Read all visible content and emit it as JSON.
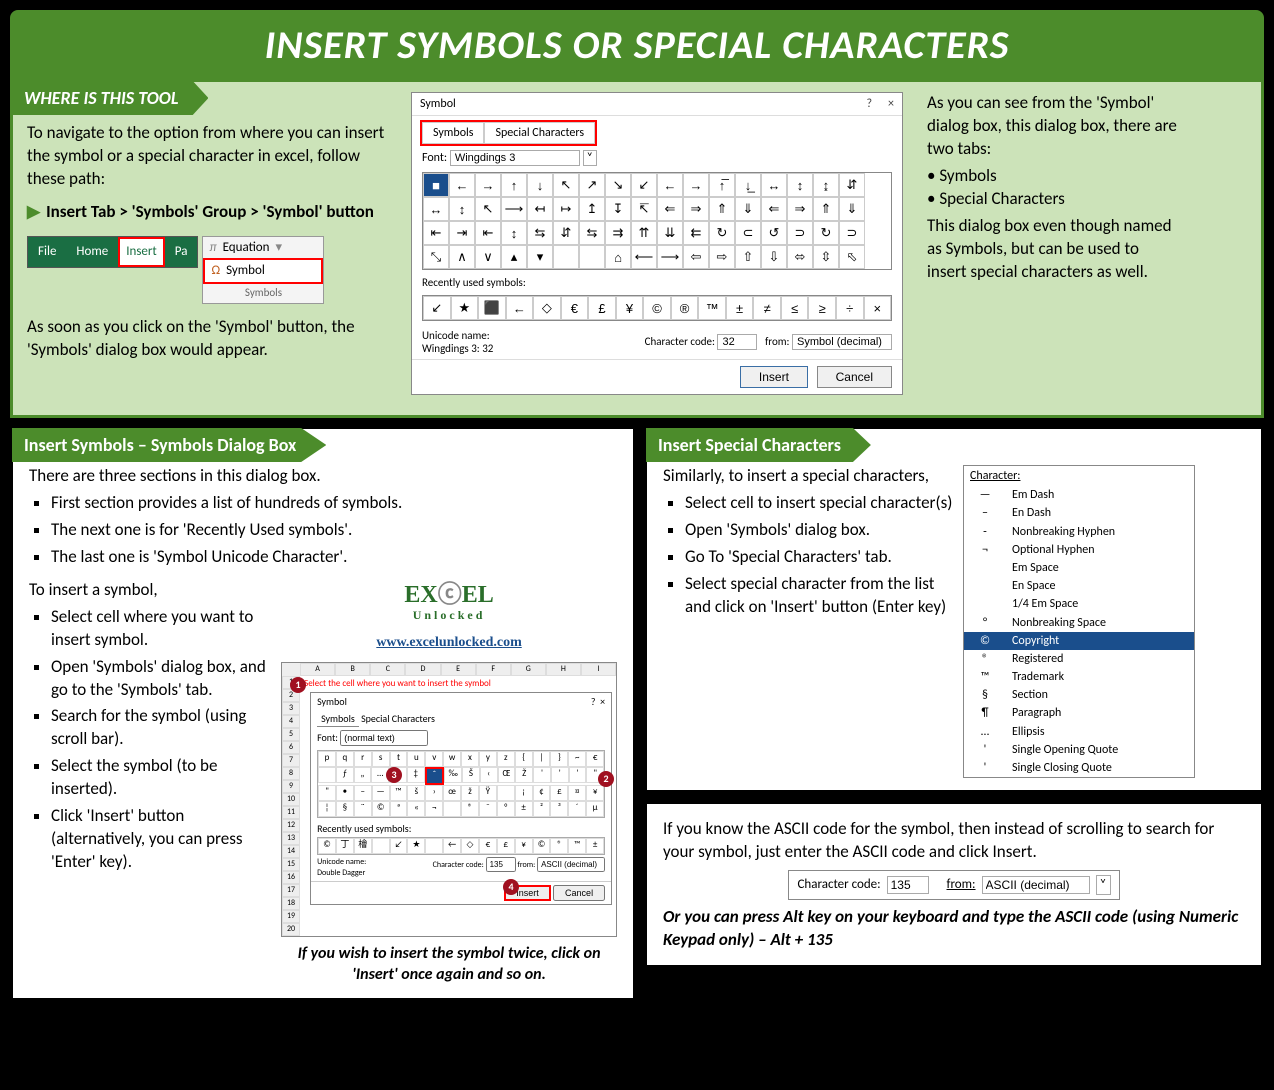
{
  "title": "INSERT SYMBOLS OR SPECIAL CHARACTERS",
  "s1": {
    "header": "WHERE IS THIS TOOL",
    "intro": "To navigate to the option from where you can insert the symbol or a special character in excel, follow these path:",
    "navpath": "Insert Tab > 'Symbols' Group > 'Symbol' button",
    "tabs": {
      "file": "File",
      "home": "Home",
      "insert": "Insert",
      "pa": "Pa"
    },
    "group": {
      "equation": "Equation",
      "symbol": "Symbol",
      "footer": "Symbols",
      "pi": "π",
      "omega": "Ω"
    },
    "after": "As soon as you click on the 'Symbol' button, the 'Symbols' dialog box would appear.",
    "dlg": {
      "title": "Symbol",
      "help": "?",
      "close": "×",
      "tabSymbols": "Symbols",
      "tabSpecial": "Special Characters",
      "fontLbl": "Font:",
      "fontVal": "Wingdings 3",
      "recentLbl": "Recently used symbols:",
      "recent": [
        "↙",
        "★",
        "⬛",
        "←",
        "◇",
        "€",
        "£",
        "¥",
        "©",
        "®",
        "™",
        "±",
        "≠",
        "≤",
        "≥",
        "÷",
        "×"
      ],
      "unicodeLbl": "Unicode name:",
      "unicodeVal": "Wingdings 3: 32",
      "charCodeLbl": "Character code:",
      "charCodeVal": "32",
      "fromLbl": "from:",
      "fromVal": "Symbol (decimal)",
      "insert": "Insert",
      "cancel": "Cancel",
      "gridRows": [
        [
          "■",
          "←",
          "→",
          "↑",
          "↓",
          "↖",
          "↗",
          "↘",
          "↙",
          "←",
          "→",
          "↑̅",
          "↓̲",
          "↔",
          "↕",
          "↨",
          "⇵"
        ],
        [
          "↔",
          "↕",
          "↖",
          "⟶",
          "↤",
          "↦",
          "↥",
          "↧",
          "↸",
          "⇐",
          "⇒",
          "⇑",
          "⇓",
          "⇐",
          "⇒",
          "⇑",
          "⇓"
        ],
        [
          "⇤",
          "⇥",
          "⇤",
          "↕",
          "⇆",
          "⇵",
          "⇆",
          "⇉",
          "⇈",
          "⇊",
          "⇇",
          "↻",
          "⊂",
          "↺",
          "⊃",
          "↻",
          "⊃"
        ],
        [
          "⤡",
          "∧",
          "∨",
          "▴",
          "▾",
          "",
          "",
          "⌂",
          "⟵",
          "⟶",
          "⇦",
          "⇨",
          "⇧",
          "⇩",
          "⬄",
          "⇳",
          "⬁"
        ]
      ]
    },
    "right": {
      "p1": "As you can see from the 'Symbol' dialog box, this dialog box, there are two tabs:",
      "b1": "Symbols",
      "b2": "Special Characters",
      "p2": "This dialog box even though named as Symbols, but can be used to insert special characters as well."
    }
  },
  "s2": {
    "header": "Insert Symbols – Symbols Dialog Box",
    "p1": "There are three sections in this dialog box.",
    "bullets1": [
      "First section provides a list of hundreds of symbols.",
      "The next one is for 'Recently Used symbols'.",
      "The last one is 'Symbol Unicode Character'."
    ],
    "p2": "To insert a symbol,",
    "bullets2": [
      "Select cell where you want to insert symbol.",
      "Open 'Symbols' dialog box, and go to the 'Symbols' tab.",
      "Search for the symbol (using scroll bar).",
      "Select the symbol (to be inserted).",
      "Click 'Insert' button (alternatively, you can press 'Enter' key)."
    ],
    "logo1": "EXCEL",
    "logo2": "Unlocked",
    "logoUrl": "www.excelunlocked.com",
    "caption": "If you wish to insert the symbol twice, click on 'Insert' once again and so on.",
    "mini": {
      "redtext": "Select the cell where you want to insert the symbol",
      "title": "Symbol",
      "tabSymbols": "Symbols",
      "tabSpecial": "Special Characters",
      "fontLbl": "Font:",
      "fontVal": "(normal text)",
      "r1": [
        "p",
        "q",
        "r",
        "s",
        "t",
        "u",
        "v",
        "w",
        "x",
        "y",
        "z",
        "{",
        "|",
        "}",
        "~",
        "€"
      ],
      "r2": [
        "",
        "ƒ",
        "„",
        "…",
        "†",
        "‡",
        "ˆ",
        "‰",
        "Š",
        "‹",
        "Œ",
        "Ž",
        "'",
        "'",
        "'",
        "\""
      ],
      "r3": [
        "\"",
        "•",
        "–",
        "—",
        "™",
        "š",
        "›",
        "œ",
        "ž",
        "Ÿ",
        "",
        "¡",
        "¢",
        "£",
        "¤",
        "¥"
      ],
      "r4": [
        "¦",
        "§",
        "¨",
        "©",
        "ª",
        "«",
        "¬",
        "",
        "®",
        "¯",
        "°",
        "±",
        "²",
        "³",
        "´",
        "µ"
      ],
      "recentLbl": "Recently used symbols:",
      "recent": [
        "©",
        "丁",
        "檜",
        "",
        "↙",
        "★",
        "",
        "←",
        "◇",
        "€",
        "£",
        "¥",
        "©",
        "®",
        "™",
        "±"
      ],
      "unicodeLbl": "Unicode name:",
      "unicodeVal": "Double Dagger",
      "charCodeLbl": "Character code:",
      "charCodeVal": "135",
      "fromLbl": "from:",
      "fromVal": "ASCII (decimal)",
      "insert": "Insert",
      "cancel": "Cancel",
      "cols": [
        "A",
        "B",
        "C",
        "D",
        "E",
        "F",
        "G",
        "H",
        "I"
      ],
      "rows": [
        "1",
        "2",
        "3",
        "4",
        "5",
        "6",
        "7",
        "8",
        "9",
        "10",
        "11",
        "12",
        "13",
        "14",
        "15",
        "16",
        "17",
        "18",
        "19",
        "20"
      ]
    }
  },
  "s3": {
    "header": "Insert Special Characters",
    "p1": "Similarly, to insert a special characters,",
    "bullets": [
      "Select cell to insert special character(s)",
      "Open 'Symbols' dialog box.",
      "Go To 'Special Characters' tab.",
      "Select special character from the list and click on 'Insert' button (Enter key)"
    ],
    "charHdr": "Character:",
    "chars": [
      {
        "s": "—",
        "n": "Em Dash"
      },
      {
        "s": "–",
        "n": "En Dash"
      },
      {
        "s": "-",
        "n": "Nonbreaking Hyphen"
      },
      {
        "s": "¬",
        "n": "Optional Hyphen"
      },
      {
        "s": "",
        "n": "Em Space"
      },
      {
        "s": "",
        "n": "En Space"
      },
      {
        "s": "",
        "n": "1/4 Em Space"
      },
      {
        "s": "°",
        "n": "Nonbreaking Space"
      },
      {
        "s": "©",
        "n": "Copyright",
        "sel": true
      },
      {
        "s": "®",
        "n": "Registered"
      },
      {
        "s": "™",
        "n": "Trademark"
      },
      {
        "s": "§",
        "n": "Section"
      },
      {
        "s": "¶",
        "n": "Paragraph"
      },
      {
        "s": "…",
        "n": "Ellipsis"
      },
      {
        "s": "'",
        "n": "Single Opening Quote"
      },
      {
        "s": "'",
        "n": "Single Closing Quote"
      }
    ]
  },
  "s4": {
    "p1": "If you know the ASCII code for the symbol, then instead of scrolling to search for your symbol, just enter the ASCII code and click Insert.",
    "charCodeLbl": "Character code:",
    "charCodeVal": "135",
    "fromLbl": "from:",
    "fromVal": "ASCII (decimal)",
    "p2": "Or you can press Alt key on your keyboard and type the ASCII code (using Numeric Keypad only) – Alt + 135"
  }
}
